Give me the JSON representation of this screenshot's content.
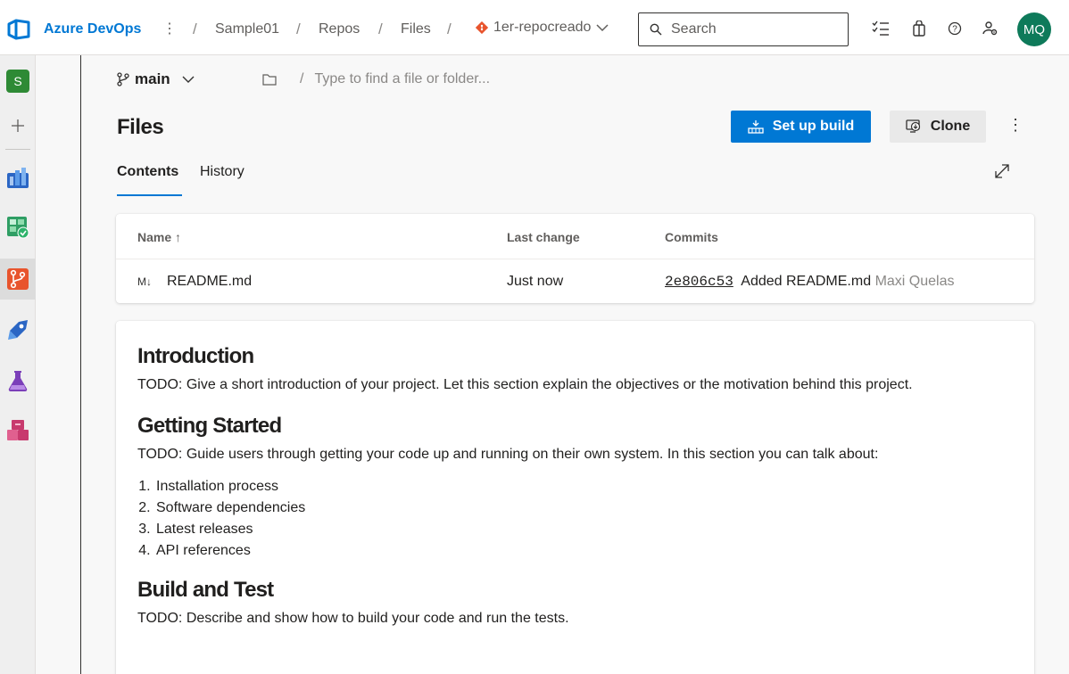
{
  "header": {
    "brand": "Azure DevOps",
    "more": "⋮",
    "breadcrumbs": [
      "Sample01",
      "Repos",
      "Files"
    ],
    "repo": "1er-repocreado",
    "search_placeholder": "Search",
    "avatar_initials": "MQ",
    "accent_color": "#0078d4"
  },
  "rail": {
    "project_initial": "S",
    "items": [
      "overview-icon",
      "boards-icon",
      "repos-icon",
      "pipelines-icon",
      "test-plans-icon",
      "artifacts-icon"
    ]
  },
  "toolbar": {
    "branch": "main",
    "path_separator": "/",
    "path_placeholder": "Type to find a file or folder..."
  },
  "page": {
    "title": "Files",
    "setup_build_label": "Set up build",
    "clone_label": "Clone",
    "more": "⋮",
    "tabs": [
      {
        "label": "Contents",
        "active": true
      },
      {
        "label": "History",
        "active": false
      }
    ]
  },
  "file_table": {
    "columns": [
      "Name ↑",
      "Last change",
      "Commits"
    ],
    "rows": [
      {
        "icon": "M↓",
        "name": "README.md",
        "last_change": "Just now",
        "commit_hash": "2e806c53",
        "commit_message": "Added README.md",
        "author": "Maxi Quelas"
      }
    ]
  },
  "readme": {
    "sections": [
      {
        "heading": "Introduction",
        "text": "TODO: Give a short introduction of your project. Let this section explain the objectives or the motivation behind this project."
      },
      {
        "heading": "Getting Started",
        "text": "TODO: Guide users through getting your code up and running on their own system. In this section you can talk about:",
        "list": [
          "Installation process",
          "Software dependencies",
          "Latest releases",
          "API references"
        ]
      },
      {
        "heading": "Build and Test",
        "text": "TODO: Describe and show how to build your code and run the tests."
      }
    ]
  }
}
